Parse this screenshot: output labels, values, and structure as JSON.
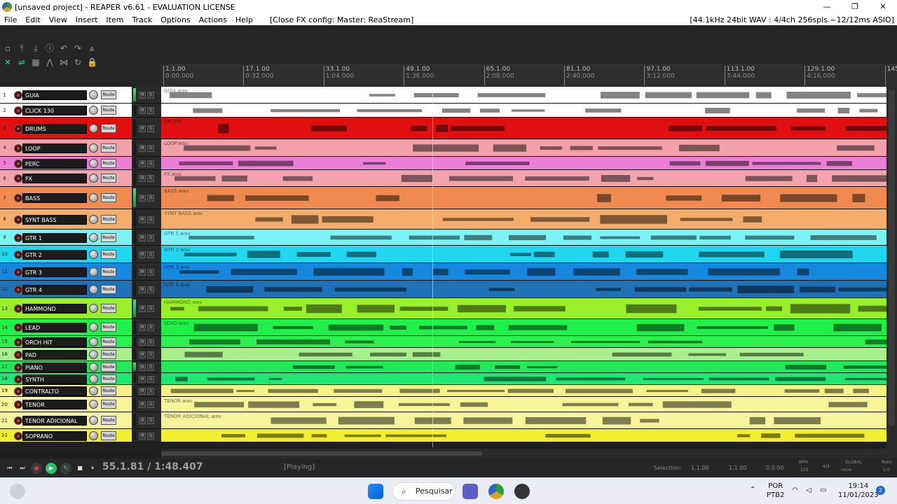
{
  "window": {
    "title": "[unsaved project] - REAPER v6.61 - EVALUATION LICENSE",
    "controls": [
      "—",
      "❐",
      "✕"
    ]
  },
  "menu": {
    "items": [
      "File",
      "Edit",
      "View",
      "Insert",
      "Item",
      "Track",
      "Options",
      "Actions",
      "Help"
    ],
    "fx_info": "[Close FX config: Master: ReaStream]",
    "status": "[44.1kHz 24bit WAV : 4/4ch 256spls ~12/12ms ASIO]"
  },
  "ruler": {
    "marks": [
      {
        "bar": "1.1.00",
        "time": "0:00.000"
      },
      {
        "bar": "17.1.00",
        "time": "0:32.000"
      },
      {
        "bar": "33.1.00",
        "time": "1:04.000"
      },
      {
        "bar": "49.1.00",
        "time": "1:36.000"
      },
      {
        "bar": "65.1.00",
        "time": "2:08.000"
      },
      {
        "bar": "81.1.00",
        "time": "2:40.000"
      },
      {
        "bar": "97.1.00",
        "time": "3:12.000"
      },
      {
        "bar": "113.1.00",
        "time": "3:44.000"
      },
      {
        "bar": "129.1.00",
        "time": "4:16.000"
      },
      {
        "bar": "145",
        "time": ""
      }
    ]
  },
  "track_labels": {
    "route": "Route",
    "mute": "M",
    "solo": "S"
  },
  "tracks": [
    {
      "num": "1",
      "name": "GUIA",
      "color": "#ffffff",
      "clip": "GUIA.wav"
    },
    {
      "num": "2",
      "name": "CLICK 130",
      "color": "#ffffff",
      "clip": ""
    },
    {
      "num": "3",
      "name": "DRUMS",
      "color": "#e01010",
      "clip": "DRUMS"
    },
    {
      "num": "4",
      "name": "LOOP",
      "color": "#f4a0a8",
      "clip": "LOOP.wav"
    },
    {
      "num": "5",
      "name": "PERC",
      "color": "#ec7ed8",
      "clip": ""
    },
    {
      "num": "6",
      "name": "FX",
      "color": "#f2a3ad",
      "clip": "FX.wav"
    },
    {
      "num": "7",
      "name": "BASS",
      "color": "#f08a50",
      "clip": "BASS.wav"
    },
    {
      "num": "8",
      "name": "SYNT BASS",
      "color": "#f5ad6c",
      "clip": "SYNT BASS.wav"
    },
    {
      "num": "9",
      "name": "GTR 1",
      "color": "#7df3f7",
      "clip": "GTR 1.wav"
    },
    {
      "num": "10",
      "name": "GTR 2",
      "color": "#1fd8f0",
      "clip": "GTR 2.wav"
    },
    {
      "num": "11",
      "name": "GTR 3",
      "color": "#1788e0",
      "clip": "GTR 3.wav"
    },
    {
      "num": "12",
      "name": "GTR 4",
      "color": "#1f72b8",
      "clip": "GTR 4.wav"
    },
    {
      "num": "13",
      "name": "HAMMOND",
      "color": "#98f02a",
      "clip": "HAMMOND.wav"
    },
    {
      "num": "14",
      "name": "LEAD",
      "color": "#22f04a",
      "clip": "LEAD.wav"
    },
    {
      "num": "15",
      "name": "ORCH HIT",
      "color": "#2bf050",
      "clip": ""
    },
    {
      "num": "16",
      "name": "PAD",
      "color": "#a8f08a",
      "clip": ""
    },
    {
      "num": "17",
      "name": "PIANO",
      "color": "#22e85a",
      "clip": ""
    },
    {
      "num": "18",
      "name": "SYNTH",
      "color": "#1ee874",
      "clip": ""
    },
    {
      "num": "19",
      "name": "CONTRALTO",
      "color": "#f7f18a",
      "clip": ""
    },
    {
      "num": "20",
      "name": "TENOR",
      "color": "#f7f49a",
      "clip": "TENOR.wav"
    },
    {
      "num": "21",
      "name": "TENOR ADICIONAL",
      "color": "#f7f49a",
      "clip": "TENOR ADICIONAL.wav"
    },
    {
      "num": "22",
      "name": "SOPRANO",
      "color": "#f2f02e",
      "clip": ""
    }
  ],
  "transport": {
    "position": "55.1.81 / 1:48.407",
    "state": "[Playing]",
    "selection_label": "Selection:",
    "selection": [
      "1.1.00",
      "1.1.00",
      "0.0.00"
    ],
    "bpm_label": "BPM",
    "bpm": "120",
    "timesig": "4/4",
    "global": "GLOBAL",
    "none": "none",
    "rate_label": "Rate:",
    "rate": "1.0"
  },
  "taskbar": {
    "search": "Pesquisar",
    "lang_top": "POR",
    "lang_bottom": "PTB2",
    "time": "19:14",
    "date": "11/01/2023",
    "notifications": "2"
  }
}
